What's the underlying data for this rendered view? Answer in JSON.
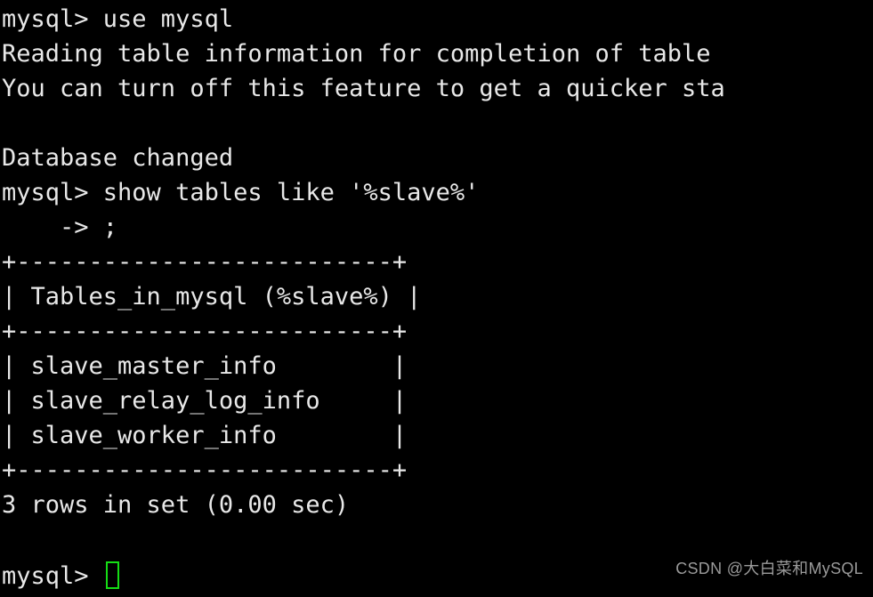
{
  "terminal": {
    "title": "mysql-client-terminal",
    "background_color": "#000000",
    "foreground_color": "#e8e8e8",
    "cursor_color": "#15dd15",
    "columns": 48,
    "rows": 17,
    "lines": [
      {
        "id": "line-1",
        "text": "mysql> use mysql"
      },
      {
        "id": "line-2",
        "text": "Reading table information for completion of table"
      },
      {
        "id": "line-3",
        "text": "You can turn off this feature to get a quicker sta"
      },
      {
        "id": "line-4",
        "text": ""
      },
      {
        "id": "line-5",
        "text": "Database changed"
      },
      {
        "id": "line-6",
        "text": "mysql> show tables like '%slave%'"
      },
      {
        "id": "line-7",
        "text": "    -> ;"
      },
      {
        "id": "line-8",
        "text": "+--------------------------+"
      },
      {
        "id": "line-9",
        "text": "| Tables_in_mysql (%slave%) |"
      },
      {
        "id": "line-10",
        "text": "+--------------------------+"
      },
      {
        "id": "line-11",
        "text": "| slave_master_info        |"
      },
      {
        "id": "line-12",
        "text": "| slave_relay_log_info     |"
      },
      {
        "id": "line-13",
        "text": "| slave_worker_info        |"
      },
      {
        "id": "line-14",
        "text": "+--------------------------+"
      },
      {
        "id": "line-15",
        "text": "3 rows in set (0.00 sec)"
      },
      {
        "id": "line-16",
        "text": ""
      }
    ],
    "prompt": {
      "text": "mysql> ",
      "cursor_glyph": "block-outline-cursor"
    },
    "result": {
      "row_count": 3,
      "status_text": "3 rows in set (0.00 sec)",
      "elapsed_seconds": "0.00"
    },
    "query": {
      "database_statement": "use mysql",
      "database_changed_message": "Database changed",
      "show_tables_statement": "show tables like '%slave%'",
      "continuation": "    -> ;",
      "pattern": "%slave%"
    },
    "table": {
      "column_header": "Tables_in_mysql (%slave%)",
      "rows": [
        "slave_master_info",
        "slave_relay_log_info",
        "slave_worker_info"
      ]
    },
    "startup_notice": {
      "line_a": "Reading table information for completion of table",
      "line_b": "You can turn off this feature to get a quicker sta"
    }
  },
  "watermark": {
    "text": "CSDN @大白菜和MySQL"
  }
}
